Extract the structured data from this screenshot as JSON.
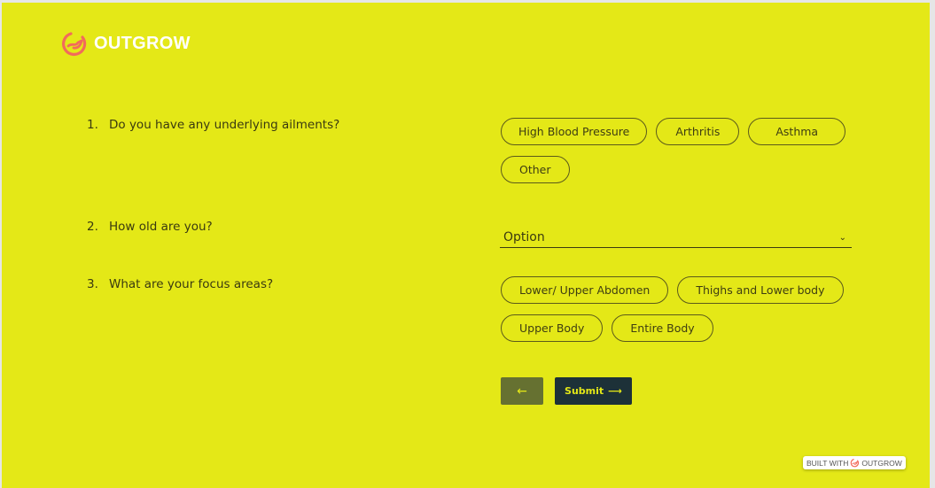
{
  "brand": {
    "name": "OUTGROW",
    "logo_icon": "outgrow-logo-icon",
    "logo_color": "#f26b5b"
  },
  "colors": {
    "background": "#e4e817",
    "back_button": "#667131",
    "submit_button": "#1d3138"
  },
  "questions": [
    {
      "number": "1.",
      "text": "Do you have any underlying ailments?",
      "type": "choices",
      "options": [
        "High Blood Pressure",
        "Arthritis",
        "Asthma",
        "Other"
      ]
    },
    {
      "number": "2.",
      "text": "How old are you?",
      "type": "select",
      "selected": "Option",
      "chevron": "chevron-down-icon"
    },
    {
      "number": "3.",
      "text": "What are your focus areas?",
      "type": "choices",
      "options": [
        "Lower/ Upper Abdomen",
        "Thighs and Lower body",
        "Upper Body",
        "Entire Body"
      ]
    }
  ],
  "nav": {
    "back_label": "←",
    "submit_label": "Submit",
    "submit_arrow": "⟶"
  },
  "footer": {
    "built_with": "BUILT WITH",
    "brand": "OUTGROW"
  }
}
